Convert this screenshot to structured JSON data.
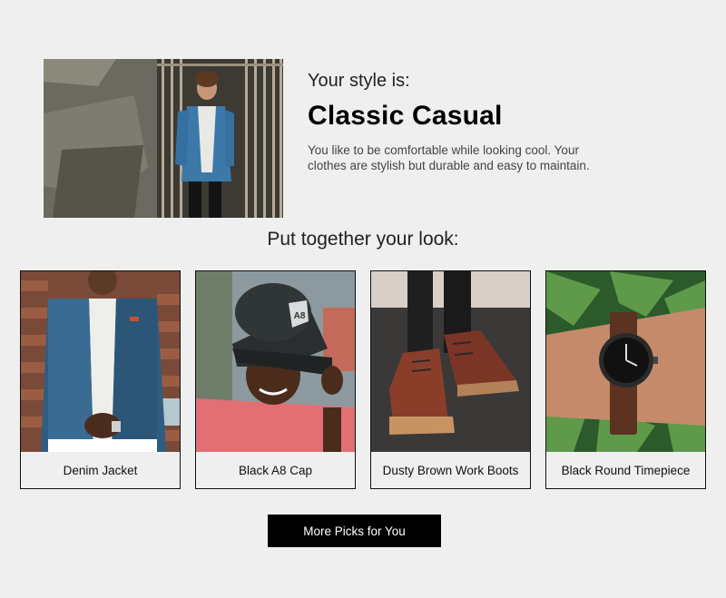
{
  "hero": {
    "intro": "Your style is:",
    "style_name": "Classic Casual",
    "description": "You like to be comfortable while looking cool. Your clothes are stylish but durable and easy to maintain."
  },
  "section": {
    "title": "Put together your look:"
  },
  "products": [
    {
      "name": "Denim Jacket",
      "icon": "denim-jacket-photo"
    },
    {
      "name": "Black A8 Cap",
      "icon": "black-cap-photo",
      "cap_text": "A8"
    },
    {
      "name": "Dusty Brown Work Boots",
      "icon": "work-boots-photo"
    },
    {
      "name": "Black Round Timepiece",
      "icon": "wristwatch-photo"
    }
  ],
  "cta": {
    "label": "More Picks for You"
  },
  "colors": {
    "background": "#efefef",
    "button_bg": "#000000",
    "button_text": "#ffffff",
    "heading": "#000000",
    "body_text": "#444444"
  }
}
